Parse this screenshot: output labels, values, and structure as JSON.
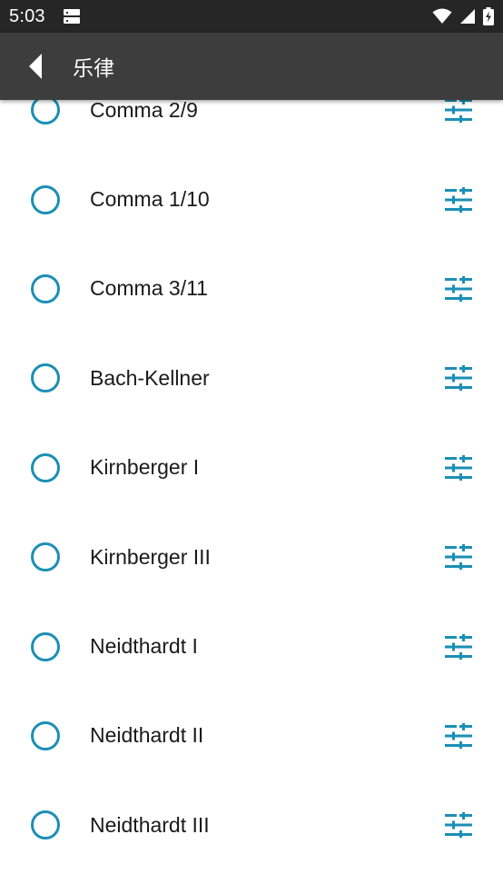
{
  "status_bar": {
    "time": "5:03",
    "icons": [
      "storage-notification-icon",
      "wifi-icon",
      "signal-icon",
      "battery-charging-icon"
    ]
  },
  "app_bar": {
    "back_icon": "back-arrow-icon",
    "title": "乐律"
  },
  "colors": {
    "accent": "#1b8fb5",
    "app_bar": "#3d3d3d",
    "status_bar": "#262626"
  },
  "temperaments": [
    {
      "label": "Comma 2/9",
      "selected": false,
      "action_icon": "tune-icon"
    },
    {
      "label": "Comma 1/10",
      "selected": false,
      "action_icon": "tune-icon"
    },
    {
      "label": "Comma 3/11",
      "selected": false,
      "action_icon": "tune-icon"
    },
    {
      "label": "Bach-Kellner",
      "selected": false,
      "action_icon": "tune-icon"
    },
    {
      "label": "Kirnberger I",
      "selected": false,
      "action_icon": "tune-icon"
    },
    {
      "label": "Kirnberger III",
      "selected": false,
      "action_icon": "tune-icon"
    },
    {
      "label": "Neidthardt I",
      "selected": false,
      "action_icon": "tune-icon"
    },
    {
      "label": "Neidthardt II",
      "selected": false,
      "action_icon": "tune-icon"
    },
    {
      "label": "Neidthardt III",
      "selected": false,
      "action_icon": "tune-icon"
    }
  ]
}
